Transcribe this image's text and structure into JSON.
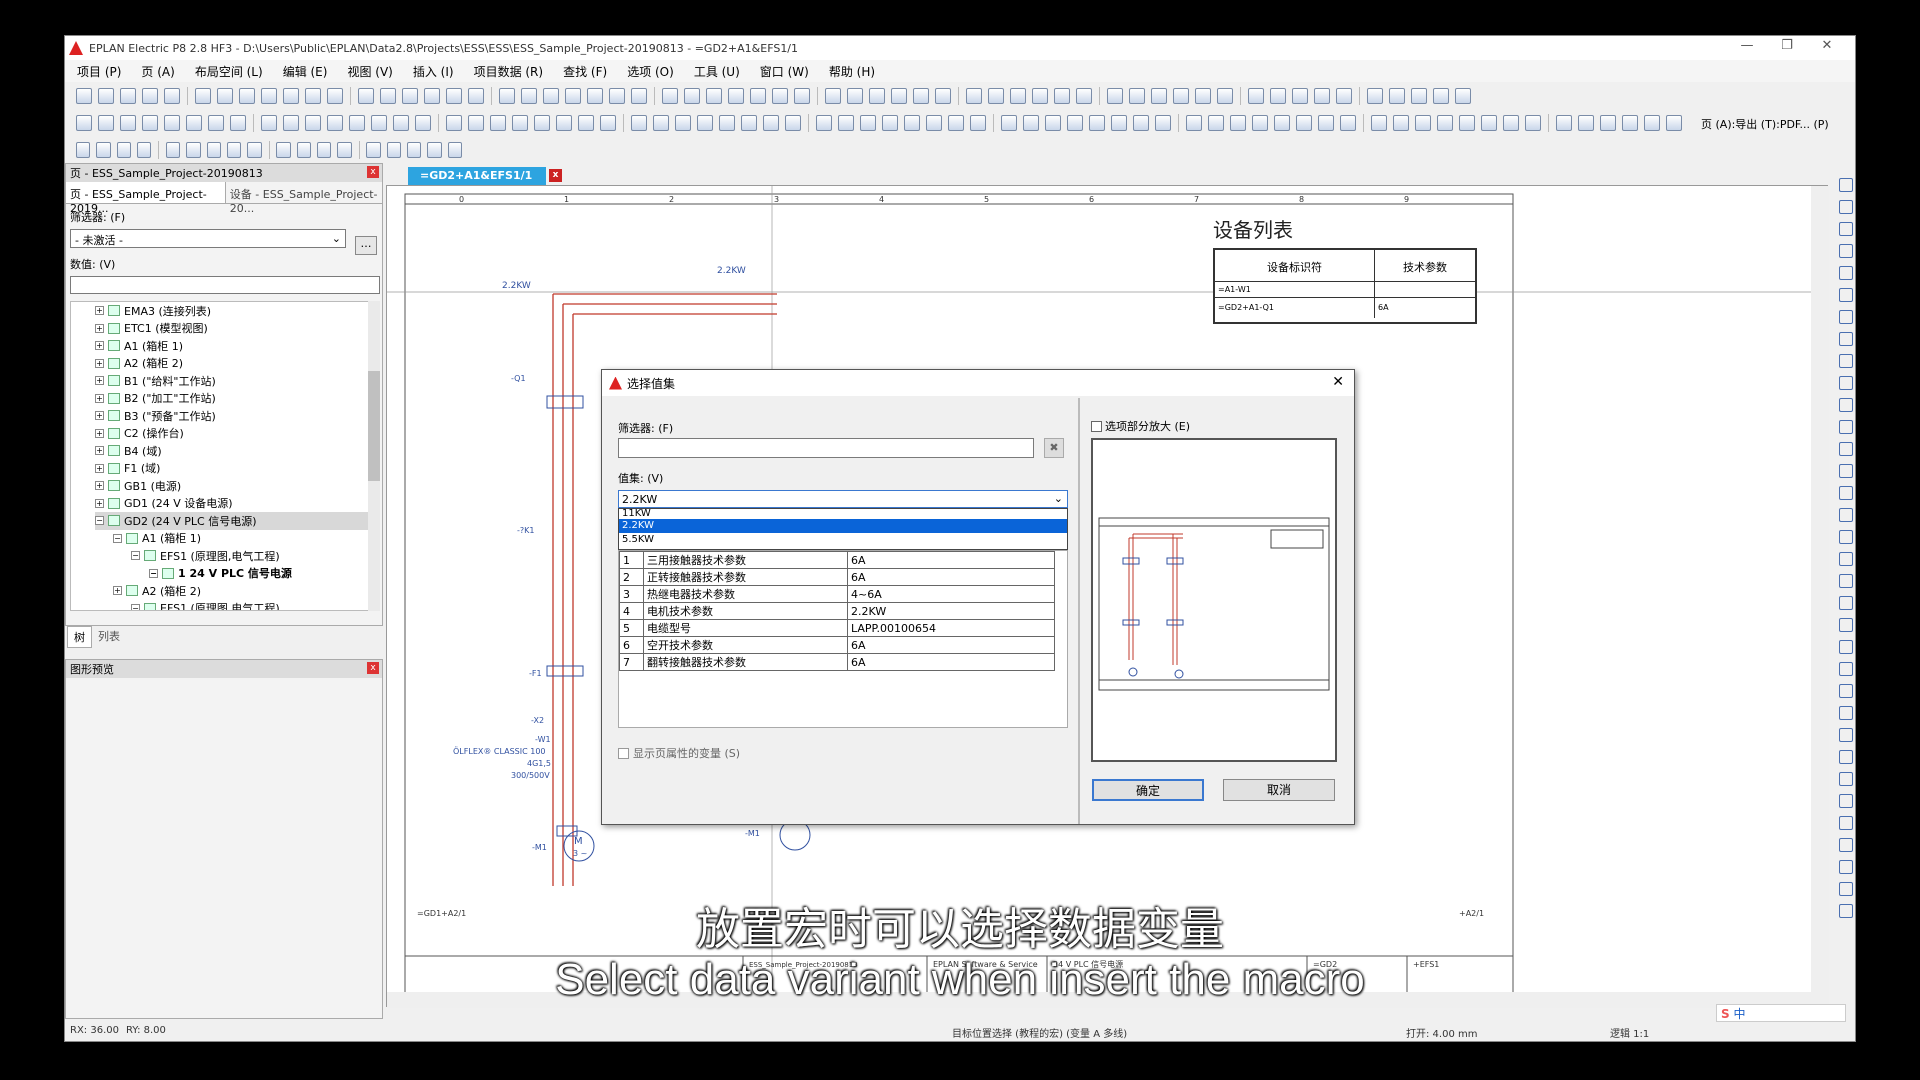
{
  "window": {
    "title": "EPLAN Electric P8 2.8 HF3 - D:\\Users\\Public\\EPLAN\\Data2.8\\Projects\\ESS\\ESS\\ESS_Sample_Project-20190813 - =GD2+A1&EFS1/1"
  },
  "menu": [
    "项目 (P)",
    "页 (A)",
    "布局空间 (L)",
    "编辑 (E)",
    "视图 (V)",
    "插入 (I)",
    "项目数据 (R)",
    "查找 (F)",
    "选项 (O)",
    "工具 (U)",
    "窗口 (W)",
    "帮助 (H)"
  ],
  "toolbar": {
    "export_label": "页 (A):导出 (T):PDF... (P)"
  },
  "page_nav": {
    "title": "页 - ESS_Sample_Project-20190813",
    "tab1": "页 - ESS_Sample_Project-2019...",
    "tab2": "设备 - ESS_Sample_Project-20...",
    "filter_label": "筛选器: (F)",
    "filter_value": "- 未激活 -",
    "value_label": "数值: (V)",
    "tree": [
      "EMA3 (连接列表)",
      "ETC1 (模型视图)",
      "A1 (箱柜 1)",
      "A2 (箱柜 2)",
      "B1 (\"给料\"工作站)",
      "B2 (\"加工\"工作站)",
      "B3 (\"预备\"工作站)",
      "C2 (操作台)",
      "B4 (域)",
      "F1 (域)",
      "GB1 (电源)",
      "GD1 (24 V 设备电源)",
      "GD2 (24 V PLC 信号电源)",
      "A1 (箱柜 1)",
      "EFS1 (原理图,电气工程)",
      "1 24 V PLC 信号电源",
      "A2 (箱柜 2)",
      "EFS1 (原理图,电气工程)"
    ],
    "bottom_tab1": "树",
    "bottom_tab2": "列表"
  },
  "preview_panel": {
    "title": "图形预览"
  },
  "doc_tab": {
    "label": "=GD2+A1&EFS1/1"
  },
  "drawing": {
    "equip_list_title": "设备列表",
    "col1": "设备标识符",
    "col2": "技术参数",
    "row1_id": "=A1-W1",
    "row2_id": "=GD2+A1-Q1",
    "row2_val": "6A",
    "power1": "2.2KW",
    "power2": "2.2KW",
    "q1": "-Q1",
    "k1": "-?K1",
    "f1": "-F1",
    "x2": "-X2",
    "w1": "-W1",
    "cable_text": "ÖLFLEX® CLASSIC 100",
    "cable_size": "4G1,5",
    "cable_volt": "300/500V",
    "m1a": "-M1",
    "m1b": "-M1",
    "m_label": "M",
    "m_sub": "3 ~",
    "footer_left": "=GD1+A2/1",
    "footer_right": "+A2/1",
    "tb_company": "EPLAN Software & Service",
    "tb_desc": "24 V PLC 信号电源",
    "tb_project": "ESS_Sample_Project-20190813",
    "tb_ref": "=GD2",
    "tb_loc": "+EFS1",
    "cols": [
      "0",
      "1",
      "2",
      "3",
      "4",
      "5",
      "6",
      "7",
      "8",
      "9"
    ]
  },
  "dialog": {
    "title": "选择值集",
    "filter_label": "筛选器: (F)",
    "valueset_label": "值集: (V)",
    "selected": "2.2KW",
    "options": [
      "11KW",
      "2.2KW",
      "5.5KW"
    ],
    "table": [
      [
        "1",
        "三用接触器技术参数",
        "6A"
      ],
      [
        "2",
        "正转接触器技术参数",
        "6A"
      ],
      [
        "3",
        "热继电器技术参数",
        "4~6A"
      ],
      [
        "4",
        "电机技术参数",
        "2.2KW"
      ],
      [
        "5",
        "电缆型号",
        "LAPP.00100654"
      ],
      [
        "6",
        "空开技术参数",
        "6A"
      ],
      [
        "7",
        "翻转接触器技术参数",
        "6A"
      ]
    ],
    "show_page_props": "显示页属性的变量 (S)",
    "zoom_label": "选项部分放大 (E)",
    "ok": "确定",
    "cancel": "取消"
  },
  "status": {
    "rx": "RX: 36.00",
    "ry": "RY: 8.00",
    "target": "目标位置选择 (教程的宏) (变量 A 多线)",
    "grid": "打开: 4.00 mm",
    "logic": "逻辑 1:1",
    "ime": "中"
  },
  "subtitle": {
    "cn": "放置宏时可以选择数据变量",
    "en": "Select data variant when insert the macro"
  }
}
